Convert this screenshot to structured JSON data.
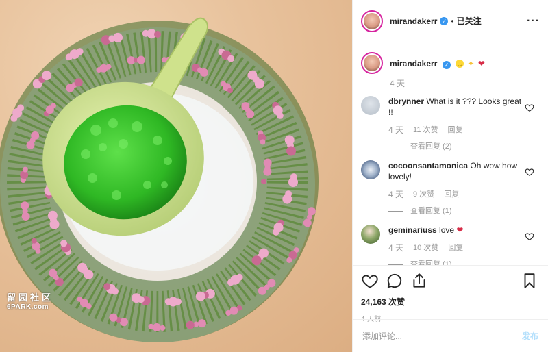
{
  "photo": {
    "watermark_cn": "留园社区",
    "watermark_en": "6PARK.com"
  },
  "header": {
    "username": "mirandakerr",
    "verified_icon": "verified-badge-icon",
    "separator": "•",
    "follow_state": "已关注",
    "more_icon": "more-options-icon",
    "more_glyph": "···"
  },
  "caption": {
    "username": "mirandakerr",
    "emojis": [
      "grinning-face",
      "sparkles",
      "heart"
    ],
    "time": "4 天"
  },
  "comments": [
    {
      "username": "dbrynner",
      "text": "What is it ??? Looks great !!",
      "time": "4 天",
      "likes": "11 次赞",
      "reply_label": "回复",
      "view_replies": "查看回复 (2)"
    },
    {
      "username": "cocoonsantamonica",
      "text": "Oh wow how lovely!",
      "time": "4 天",
      "likes": "9 次赞",
      "reply_label": "回复",
      "view_replies": "查看回复 (1)"
    },
    {
      "username": "geminariuss",
      "text": "love",
      "time": "4 天",
      "likes": "10 次赞",
      "reply_label": "回复",
      "view_replies": "查看回复 (1)"
    }
  ],
  "actions": {
    "like_icon": "heart-outline-icon",
    "comment_icon": "comment-bubble-icon",
    "share_icon": "share-icon",
    "save_icon": "bookmark-icon",
    "likes_count": "24,163 次赞",
    "posted": "4 天前"
  },
  "composer": {
    "placeholder": "添加评论...",
    "post_label": "发布"
  },
  "colors": {
    "verified": "#3897f0",
    "muted": "#999999",
    "post_disabled": "#b2dffc",
    "border": "#efefef"
  }
}
